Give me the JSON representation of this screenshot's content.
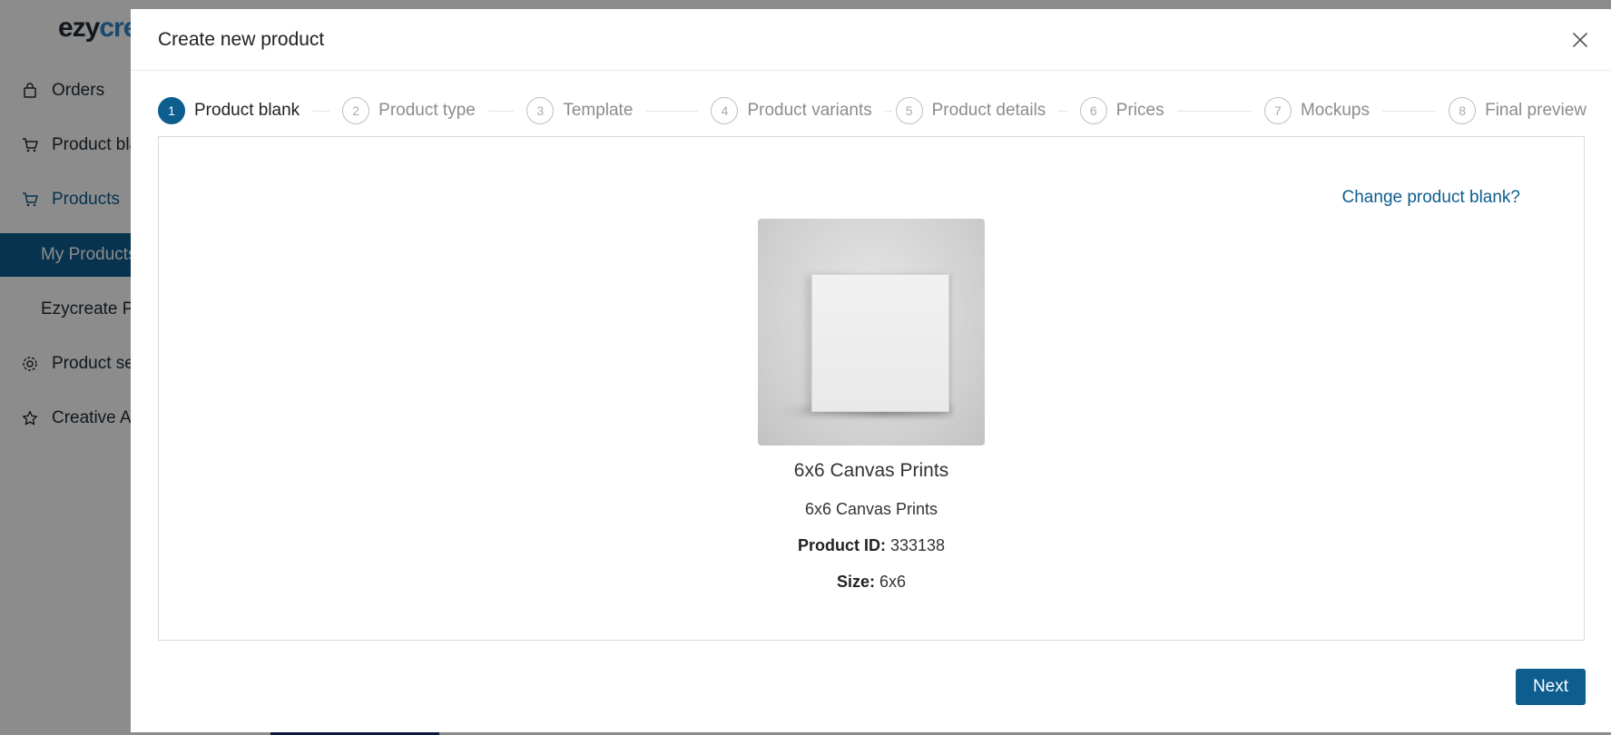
{
  "app": {
    "brand_part1": "ezy",
    "brand_part2": "cre",
    "sidebar": [
      {
        "label": "Orders",
        "icon": "bag-icon"
      },
      {
        "label": "Product bla",
        "icon": "cart-icon"
      },
      {
        "label": "Products",
        "icon": "cart-icon"
      },
      {
        "label": "My Products",
        "icon": ""
      },
      {
        "label": "Ezycreate P",
        "icon": ""
      },
      {
        "label": "Product se",
        "icon": "gear-icon"
      },
      {
        "label": "Creative A",
        "icon": "star-icon"
      }
    ]
  },
  "modal": {
    "title": "Create new product",
    "steps": [
      {
        "num": "1",
        "label": "Product blank"
      },
      {
        "num": "2",
        "label": "Product type"
      },
      {
        "num": "3",
        "label": "Template"
      },
      {
        "num": "4",
        "label": "Product variants"
      },
      {
        "num": "5",
        "label": "Product details"
      },
      {
        "num": "6",
        "label": "Prices"
      },
      {
        "num": "7",
        "label": "Mockups"
      },
      {
        "num": "8",
        "label": "Final preview"
      }
    ],
    "active_step": 1,
    "change_link": "Change product blank?",
    "product": {
      "name": "6x6 Canvas Prints",
      "subtitle": "6x6 Canvas Prints",
      "id_label": "Product ID:",
      "id_value": "333138",
      "size_label": "Size:",
      "size_value": "6x6"
    },
    "next_label": "Next"
  },
  "colors": {
    "accent": "#0d5d8f",
    "brand_blue": "#2c86c9",
    "overlay": "rgba(0,0,0,0.45)"
  }
}
